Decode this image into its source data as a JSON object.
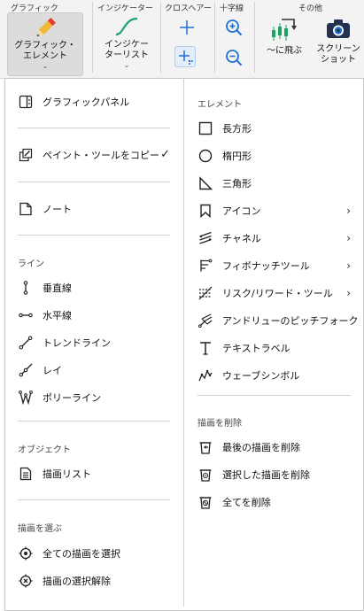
{
  "ribbon": {
    "groups": [
      "グラフィック",
      "インジケーター",
      "クロスヘアー",
      "十字線",
      "その他"
    ],
    "graphic_button": "グラフィック・\nエレメント",
    "indicator_button": "インジケー\nターリスト",
    "jump_button": "〜に飛ぶ",
    "screenshot_button": "スクリーン\nショット"
  },
  "menu": {
    "left": {
      "graphic_panel": "グラフィックパネル",
      "copy_paint_tool": "ペイント・ツールをコピー",
      "copy_checked": "✓",
      "note": "ノート",
      "lines_header": "ライン",
      "lines": [
        "垂直線",
        "水平線",
        "トレンドライン",
        "レイ",
        "ポリーライン"
      ],
      "objects_header": "オブジェクト",
      "drawing_list": "描画リスト",
      "select_header": "描画を選ぶ",
      "select_all": "全ての描画を選択",
      "deselect": "描画の選択解除"
    },
    "right": {
      "elements_header": "エレメント",
      "elements": [
        "長方形",
        "楕円形",
        "三角形",
        "アイコン",
        "チャネル",
        "フィボナッチツール",
        "リスク/リワード・ツール",
        "アンドリューのピッチフォーク",
        "テキストラベル",
        "ウェーブシンボル"
      ],
      "delete_header": "描画を削除",
      "delete_items": [
        "最後の描画を削除",
        "選択した描画を削除",
        "全てを削除"
      ]
    }
  },
  "colors": {
    "accent_blue": "#1e6fd0",
    "pencil_red": "#e23b2e",
    "pencil_yellow": "#f2b63a",
    "indicator_teal": "#1aa37a",
    "candle_green": "#19a463",
    "camera_navy": "#22314f"
  }
}
